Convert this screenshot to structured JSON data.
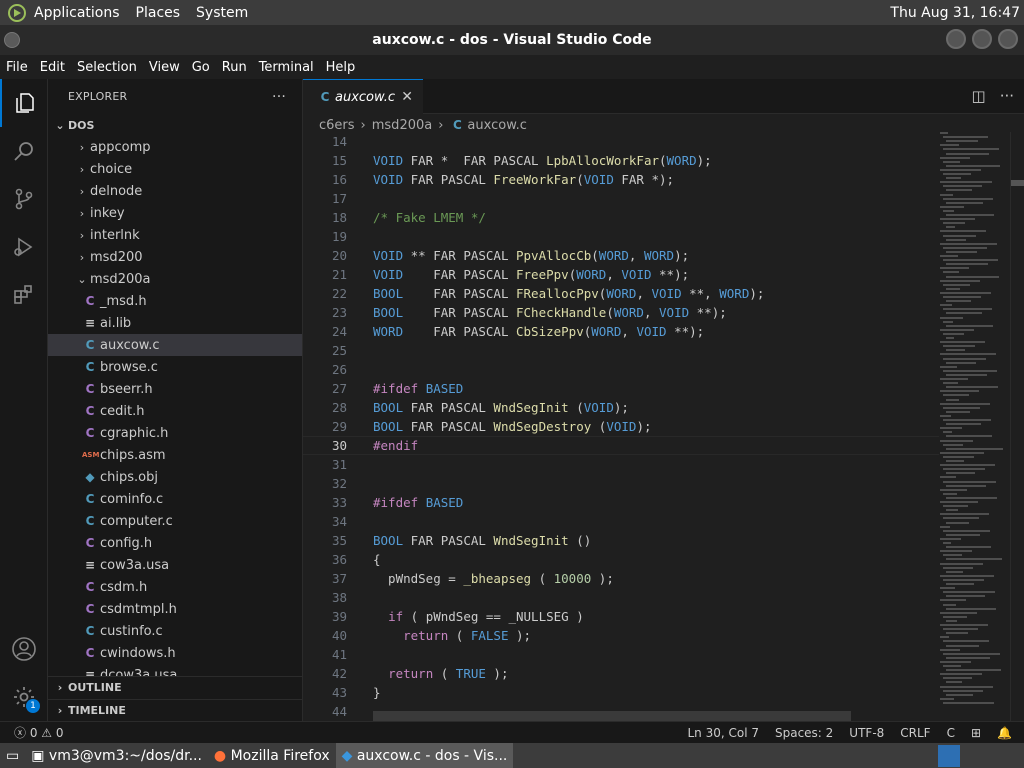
{
  "top_panel": {
    "menus": [
      "Applications",
      "Places",
      "System"
    ],
    "clock": "Thu Aug 31, 16:47"
  },
  "window": {
    "title": "auxcow.c - dos - Visual Studio Code"
  },
  "menubar": [
    "File",
    "Edit",
    "Selection",
    "View",
    "Go",
    "Run",
    "Terminal",
    "Help"
  ],
  "sidebar": {
    "title": "EXPLORER",
    "more": "···",
    "root": "DOS",
    "folders": [
      "appcomp",
      "choice",
      "delnode",
      "inkey",
      "interlnk",
      "msd200"
    ],
    "open_folder": "msd200a",
    "files": [
      {
        "name": "_msd.h",
        "icon": "C",
        "type": "h"
      },
      {
        "name": "ai.lib",
        "icon": "≡",
        "type": "lib"
      },
      {
        "name": "auxcow.c",
        "icon": "C",
        "type": "c"
      },
      {
        "name": "browse.c",
        "icon": "C",
        "type": "c"
      },
      {
        "name": "bseerr.h",
        "icon": "C",
        "type": "h"
      },
      {
        "name": "cedit.h",
        "icon": "C",
        "type": "h"
      },
      {
        "name": "cgraphic.h",
        "icon": "C",
        "type": "h"
      },
      {
        "name": "chips.asm",
        "icon": "ASM",
        "type": "asm"
      },
      {
        "name": "chips.obj",
        "icon": "◆",
        "type": "obj"
      },
      {
        "name": "cominfo.c",
        "icon": "C",
        "type": "c"
      },
      {
        "name": "computer.c",
        "icon": "C",
        "type": "c"
      },
      {
        "name": "config.h",
        "icon": "C",
        "type": "h"
      },
      {
        "name": "cow3a.usa",
        "icon": "≡",
        "type": "usa"
      },
      {
        "name": "csdm.h",
        "icon": "C",
        "type": "h"
      },
      {
        "name": "csdmtmpl.h",
        "icon": "C",
        "type": "h"
      },
      {
        "name": "custinfo.c",
        "icon": "C",
        "type": "c"
      },
      {
        "name": "cwindows.h",
        "icon": "C",
        "type": "h"
      },
      {
        "name": "dcow3a.usa",
        "icon": "≡",
        "type": "usa"
      }
    ],
    "sections": [
      "OUTLINE",
      "TIMELINE"
    ]
  },
  "editor": {
    "tab": {
      "label": "auxcow.c",
      "icon": "C",
      "close": "✕"
    },
    "breadcrumb": [
      "c6ers",
      "msd200a",
      "auxcow.c"
    ],
    "lines": [
      {
        "n": "14",
        "t": ""
      },
      {
        "n": "15",
        "t": "VOID FAR *  FAR PASCAL LpbAllocWorkFar(WORD);"
      },
      {
        "n": "16",
        "t": "VOID FAR PASCAL FreeWorkFar(VOID FAR *);"
      },
      {
        "n": "17",
        "t": ""
      },
      {
        "n": "18",
        "t": "/* Fake LMEM */"
      },
      {
        "n": "19",
        "t": ""
      },
      {
        "n": "20",
        "t": "VOID ** FAR PASCAL PpvAllocCb(WORD, WORD);"
      },
      {
        "n": "21",
        "t": "VOID    FAR PASCAL FreePpv(WORD, VOID **);"
      },
      {
        "n": "22",
        "t": "BOOL    FAR PASCAL FReallocPpv(WORD, VOID **, WORD);"
      },
      {
        "n": "23",
        "t": "BOOL    FAR PASCAL FCheckHandle(WORD, VOID **);"
      },
      {
        "n": "24",
        "t": "WORD    FAR PASCAL CbSizePpv(WORD, VOID **);"
      },
      {
        "n": "25",
        "t": ""
      },
      {
        "n": "26",
        "t": ""
      },
      {
        "n": "27",
        "t": "#ifdef BASED"
      },
      {
        "n": "28",
        "t": "BOOL FAR PASCAL WndSegInit (VOID);"
      },
      {
        "n": "29",
        "t": "BOOL FAR PASCAL WndSegDestroy (VOID);"
      },
      {
        "n": "30",
        "t": "#endif"
      },
      {
        "n": "31",
        "t": ""
      },
      {
        "n": "32",
        "t": ""
      },
      {
        "n": "33",
        "t": "#ifdef BASED"
      },
      {
        "n": "34",
        "t": ""
      },
      {
        "n": "35",
        "t": "BOOL FAR PASCAL WndSegInit ()"
      },
      {
        "n": "36",
        "t": "{"
      },
      {
        "n": "37",
        "t": "  pWndSeg = _bheapseg ( 10000 );"
      },
      {
        "n": "38",
        "t": ""
      },
      {
        "n": "39",
        "t": "  if ( pWndSeg == _NULLSEG )"
      },
      {
        "n": "40",
        "t": "    return ( FALSE );"
      },
      {
        "n": "41",
        "t": ""
      },
      {
        "n": "42",
        "t": "  return ( TRUE );"
      },
      {
        "n": "43",
        "t": "}"
      },
      {
        "n": "44",
        "t": ""
      }
    ]
  },
  "statusbar": {
    "errors": "0",
    "warnings": "0",
    "position": "Ln 30, Col 7",
    "spaces": "Spaces: 2",
    "encoding": "UTF-8",
    "eol": "CRLF",
    "language": "C"
  },
  "taskbar": {
    "items": [
      "vm3@vm3:~/dos/dr...",
      "Mozilla Firefox",
      "auxcow.c - dos - Vis..."
    ]
  },
  "accounts_badge": "1"
}
